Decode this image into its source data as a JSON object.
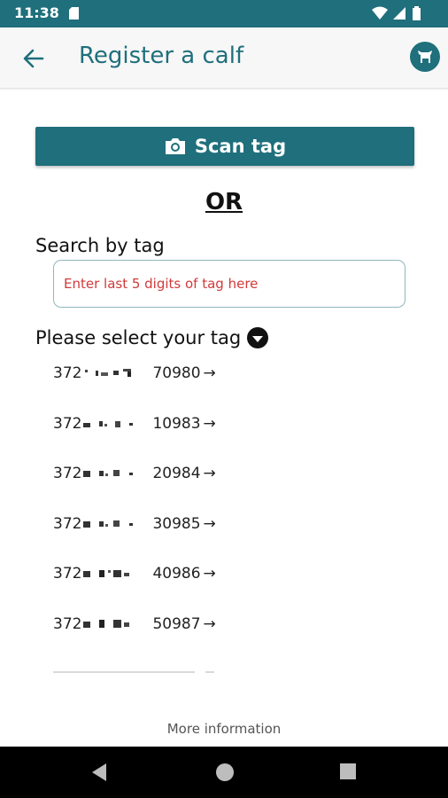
{
  "status_bar": {
    "time": "11:38",
    "icons": [
      "sd-card-icon",
      "wifi-icon",
      "signal-icon",
      "battery-icon"
    ]
  },
  "app_bar": {
    "title": "Register a calf",
    "back_icon": "arrow-left-icon",
    "action_icon": "cow-icon"
  },
  "scan_button": {
    "label": "Scan tag",
    "icon": "camera-icon"
  },
  "or_text": "OR",
  "search": {
    "label": "Search by tag",
    "placeholder": "Enter last 5 digits of tag here",
    "value": ""
  },
  "tag_select": {
    "label": "Please select your tag",
    "icon": "dropdown-circle-icon",
    "items": [
      {
        "prefix": "372",
        "suffix": "70980"
      },
      {
        "prefix": "372",
        "suffix": "10983"
      },
      {
        "prefix": "372",
        "suffix": "20984"
      },
      {
        "prefix": "372",
        "suffix": "30985"
      },
      {
        "prefix": "372",
        "suffix": "40986"
      },
      {
        "prefix": "372",
        "suffix": "50987"
      }
    ],
    "arrow": "→"
  },
  "footer": {
    "more_info": "More information"
  },
  "nav_bar": {
    "icons": [
      "back-triangle-icon",
      "home-circle-icon",
      "recents-square-icon"
    ]
  },
  "colors": {
    "primary": "#1f6f7c",
    "placeholder_red": "#d23a3a",
    "background": "#ffffff"
  }
}
